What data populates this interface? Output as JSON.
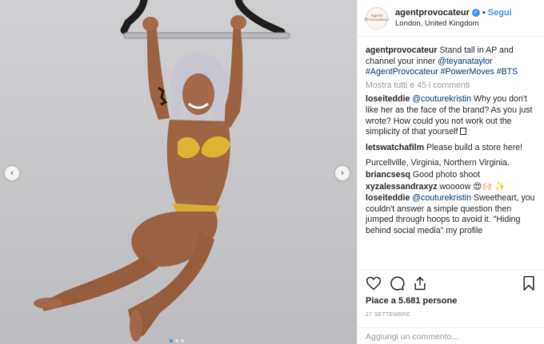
{
  "account": {
    "username": "agentprovocateur",
    "avatar_text": "Agent Provocateur",
    "verified_icon": "verified-badge-icon",
    "separator": "•",
    "follow_label": "Segui",
    "location": "London, United Kingdom"
  },
  "caption": {
    "user": "agentprovocateur",
    "text_1": "Stand tall in AP and channel your inner ",
    "mention": "@teyanataylor",
    "tags": "#AgentProvocateur #PowerMoves #BTS"
  },
  "show_all": "Mostra tutti e 45 i commenti",
  "comments": [
    {
      "user": "loseiteddie",
      "mention": "@couturekristin",
      "text": " Why you don't like her as the face of the brand? As you just wrote? How could you not work out the simplicity of that yourself "
    },
    {
      "user": "letswatchafilm",
      "text": " Please build a store here!"
    },
    {
      "text": "Purcellville, Virginia, Northern Virginia."
    },
    {
      "user": "briancsesq",
      "text": " Good photo shoot"
    },
    {
      "user": "xyzalessandraxyz",
      "text": " woooow 😍🙌🏻",
      "sparkle": "✨"
    },
    {
      "user": "loseiteddie",
      "mention": "@couturekristin",
      "text": " Sweetheart, you couldn't answer a simple question then jumped through hoops to avoid it. \"Hiding behind social media\" my profile"
    }
  ],
  "actions": {
    "like_icon": "heart-icon",
    "comment_icon": "comment-bubble-icon",
    "share_icon": "share-icon",
    "save_icon": "bookmark-icon"
  },
  "likes": "Piace a 5.681 persone",
  "date": "27 SETTEMBRE",
  "add_comment_placeholder": "Aggiungi un commento...",
  "carousel": {
    "prev_icon": "chevron-left-icon",
    "next_icon": "chevron-right-icon",
    "slides": 3,
    "active_slide": 1
  },
  "colors": {
    "link": "#3897f0",
    "tag": "#003569",
    "muted": "#999999",
    "bikini": "#e0b233"
  }
}
